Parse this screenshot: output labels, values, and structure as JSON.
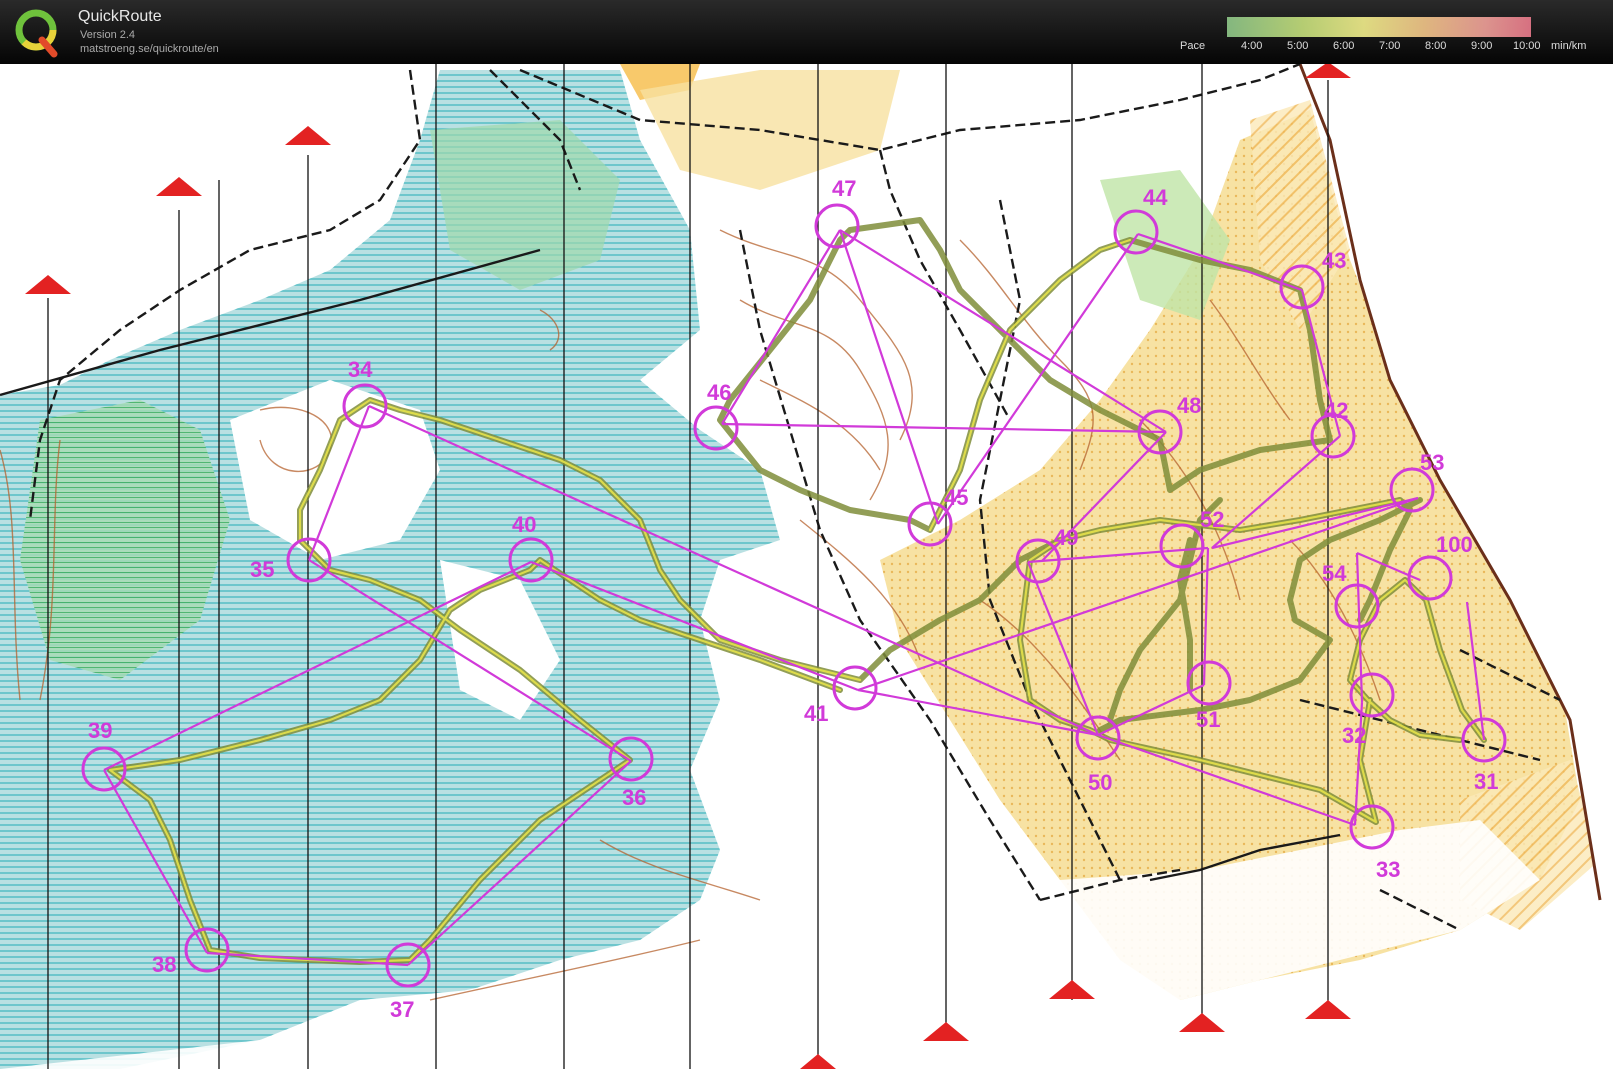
{
  "app": {
    "name": "QuickRoute",
    "version": "Version 2.4",
    "url": "matstroeng.se/quickroute/en"
  },
  "pace_scale": {
    "label": "Pace",
    "ticks": [
      "4:00",
      "5:00",
      "6:00",
      "7:00",
      "8:00",
      "9:00",
      "10:00"
    ],
    "unit": "min/km"
  },
  "course": {
    "line_color": "#d13ad9",
    "controls": [
      "31",
      "32",
      "33",
      "34",
      "35",
      "36",
      "37",
      "38",
      "39",
      "40",
      "41",
      "42",
      "43",
      "44",
      "45",
      "46",
      "47",
      "48",
      "49",
      "50",
      "51",
      "52",
      "53",
      "54",
      "100"
    ]
  }
}
